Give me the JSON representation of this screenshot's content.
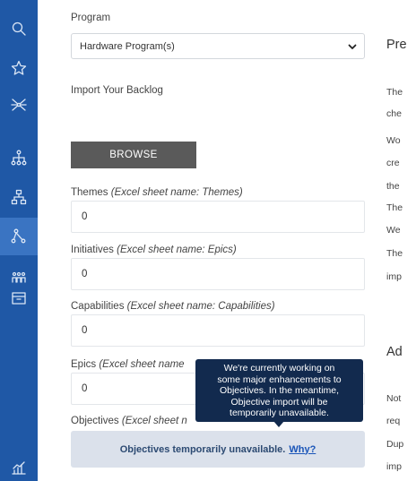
{
  "sidebar": {
    "items": [
      {
        "icon": "search-icon",
        "active": false
      },
      {
        "icon": "star-icon",
        "active": false
      },
      {
        "icon": "network-icon",
        "active": false
      },
      {
        "icon": "hierarchy-icon",
        "active": false
      },
      {
        "icon": "org-chart-icon",
        "active": false
      },
      {
        "icon": "tree-icon",
        "active": true
      },
      {
        "icon": "people-icon",
        "active": false
      },
      {
        "icon": "archive-icon",
        "active": false
      },
      {
        "icon": "chart-icon",
        "active": false
      }
    ],
    "color": "#1f58a6"
  },
  "form": {
    "program_label": "Program",
    "program_value": "Hardware Program(s)",
    "import_label": "Import Your Backlog",
    "browse_label": "BROWSE",
    "themes": {
      "label": "Themes",
      "hint": "(Excel sheet name: Themes)",
      "value": "0"
    },
    "initiatives": {
      "label": "Initiatives",
      "hint": "(Excel sheet name: Epics)",
      "value": "0"
    },
    "capabilities": {
      "label": "Capabilities",
      "hint": "(Excel sheet name: Capabilities)",
      "value": "0"
    },
    "epics": {
      "label": "Epics",
      "hint": "(Excel sheet name",
      "value": "0"
    },
    "objectives": {
      "label": "Objectives",
      "hint": "(Excel sheet n"
    },
    "notice_text": "Objectives temporarily unavailable.",
    "notice_link": "Why?"
  },
  "tooltip": {
    "lines": [
      "We're currently working on",
      "some major enhancements to",
      "Objectives. In the meantime,",
      "Objective import will be",
      "temporarily unavailable."
    ]
  },
  "right_panel": {
    "heading1": "Pre",
    "text1": [
      "The",
      "che",
      "Wo",
      "cre",
      "the",
      "The",
      "We",
      "The",
      "imp"
    ],
    "heading2": "Ad",
    "text2": [
      "Not",
      "req",
      "Dup",
      "imp"
    ]
  }
}
